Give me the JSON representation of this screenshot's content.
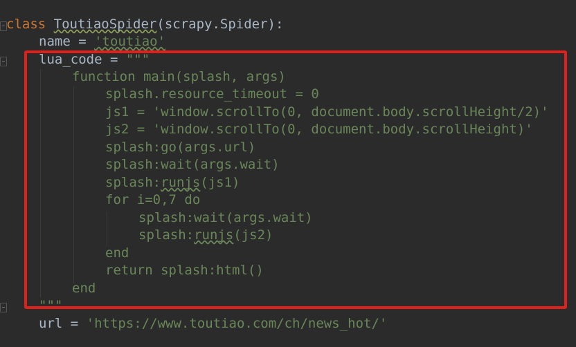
{
  "code": {
    "line1": {
      "kw": "class",
      "name": "ToutiaoSpider",
      "rest": "(scrapy.Spider):"
    },
    "line2": {
      "prefix": "name = ",
      "str": "'toutiao'"
    },
    "line3": {
      "prefix": "lua_code = ",
      "str": "\"\"\""
    },
    "line4": "function main(splash, args)",
    "line5": "splash.resource_timeout = 0",
    "line6": "js1 = 'window.scrollTo(0, document.body.scrollHeight/2)'",
    "line7": "js2 = 'window.scrollTo(0, document.body.scrollHeight)'",
    "line8": "splash:go(args.url)",
    "line9": "splash:wait(args.wait)",
    "line10": {
      "a": "splash:",
      "b": "runjs",
      "c": "(js1)"
    },
    "line11": "for i=0,7 do",
    "line12": "splash:wait(args.wait)",
    "line13": {
      "a": "splash:",
      "b": "runjs",
      "c": "(js2)"
    },
    "line14": "end",
    "line15": "return splash:html()",
    "line16": "end",
    "line17": "\"\"\"",
    "line18": {
      "prefix": "url = ",
      "str": "'https://www.toutiao.com/ch/news_hot/'"
    }
  },
  "colors": {
    "background": "#2b2b2b",
    "keyword": "#cc7832",
    "string": "#6a8759",
    "text": "#a9b7c6",
    "highlight_box": "#e0201b"
  }
}
